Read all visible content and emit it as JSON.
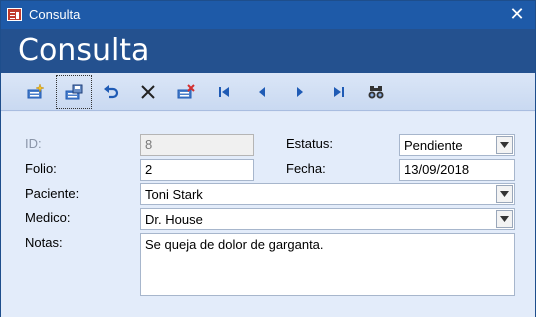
{
  "window": {
    "title": "Consulta",
    "close_glyph": "✕"
  },
  "header": {
    "title": "Consulta"
  },
  "toolbar": {
    "buttons": [
      {
        "name": "new-record-icon"
      },
      {
        "name": "save-record-icon"
      },
      {
        "name": "undo-icon"
      },
      {
        "name": "delete-icon"
      },
      {
        "name": "delete-record-icon"
      },
      {
        "name": "first-record-icon"
      },
      {
        "name": "previous-record-icon"
      },
      {
        "name": "next-record-icon"
      },
      {
        "name": "last-record-icon"
      },
      {
        "name": "find-binoculars-icon"
      }
    ]
  },
  "form": {
    "id": {
      "label": "ID:",
      "value": "8"
    },
    "estatus": {
      "label": "Estatus:",
      "value": "Pendiente"
    },
    "folio": {
      "label": "Folio:",
      "value": "2"
    },
    "fecha": {
      "label": "Fecha:",
      "value": "13/09/2018"
    },
    "paciente": {
      "label": "Paciente:",
      "value": "Toni Stark"
    },
    "medico": {
      "label": "Medico:",
      "value": "Dr. House"
    },
    "notas": {
      "label": "Notas:",
      "value": "Se queja de dolor de garganta."
    }
  },
  "colors": {
    "titlebar": "#1e5aa8",
    "header": "#24518f",
    "toolbar_icon": "#1f5bb5",
    "form_background": "#e3ecfa"
  }
}
